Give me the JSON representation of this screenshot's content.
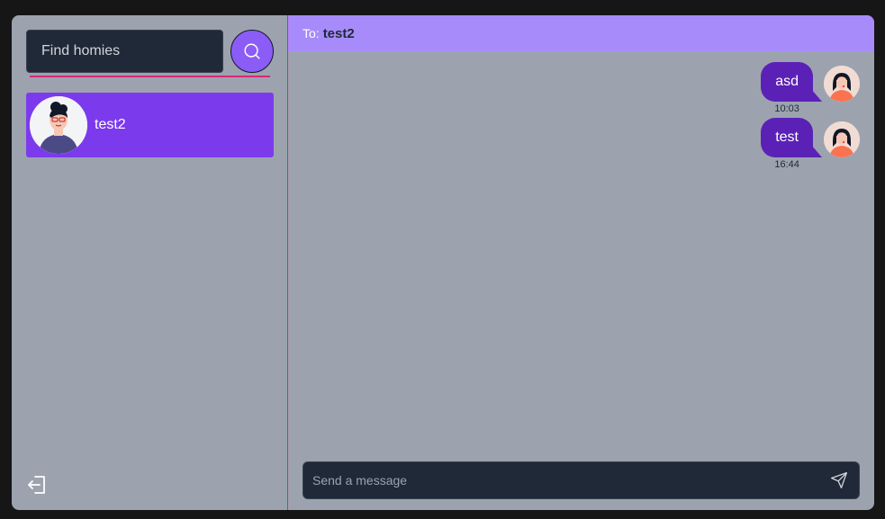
{
  "sidebar": {
    "search": {
      "placeholder": "Find homies",
      "value": "",
      "icon": "search-icon"
    },
    "contacts": [
      {
        "name": "test2",
        "avatar_icon": "male-avatar-icon"
      }
    ],
    "logout_icon": "logout-icon"
  },
  "chat": {
    "header": {
      "prefix": "To:",
      "recipient": "test2"
    },
    "messages": [
      {
        "text": "asd",
        "time": "10:03",
        "avatar_icon": "female-avatar-icon"
      },
      {
        "text": "test",
        "time": "16:44",
        "avatar_icon": "female-avatar-icon"
      }
    ],
    "composer": {
      "placeholder": "Send a message",
      "value": "",
      "send_icon": "send-icon"
    }
  },
  "colors": {
    "page_bg": "#161616",
    "panel_bg": "#9ca3af",
    "accent_violet": "#7c3aed",
    "header_bg": "#a78bfa",
    "bubble_bg": "#5b21b6",
    "divider_pink": "#db2777",
    "input_bg": "#1f2937"
  }
}
